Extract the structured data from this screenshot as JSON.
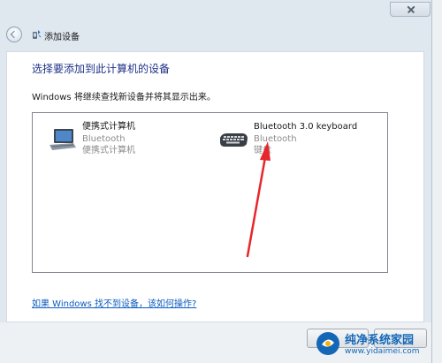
{
  "dialog": {
    "title": "添加设备",
    "heading": "选择要添加到此计算机的设备",
    "subtext": "Windows 将继续查找新设备并将其显示出来。",
    "help_link": "如果 Windows 找不到设备，该如何操作?"
  },
  "devices": [
    {
      "name": "便携式计算机",
      "connection": "Bluetooth",
      "category": "便携式计算机",
      "icon": "laptop-icon"
    },
    {
      "name": "Bluetooth 3.0 keyboard",
      "connection": "Bluetooth",
      "category": "键盘",
      "icon": "keyboard-icon"
    }
  ],
  "annotation": {
    "color": "#e8262b",
    "icon": "red-arrow"
  },
  "watermark": {
    "name": "纯净系统家园",
    "url": "www.yidaimei.com",
    "icon": "watermark-logo"
  },
  "colors": {
    "heading": "#1e3287",
    "link": "#0b5cbf",
    "muted": "#8c8c8c"
  }
}
